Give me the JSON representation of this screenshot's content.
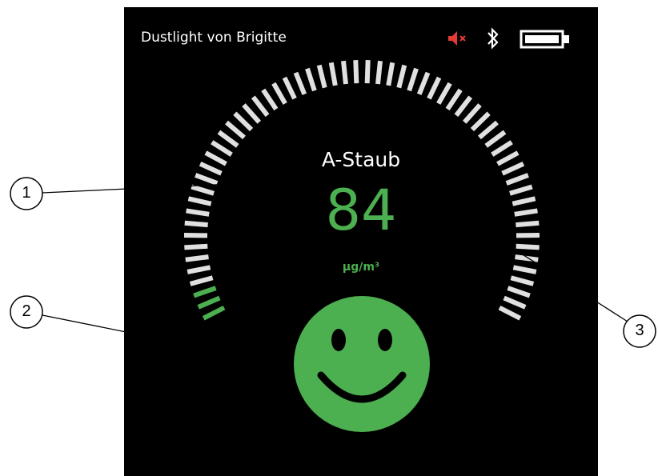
{
  "header": {
    "title": "Dustlight von Brigitte",
    "icons": [
      "speaker-muted-icon",
      "bluetooth-icon",
      "battery-icon"
    ]
  },
  "measurement": {
    "label": "A-Staub",
    "value": "84",
    "unit": "µg/m³",
    "gauge_fill_fraction": 0.05,
    "status": "good",
    "status_icon": "smiley-happy-icon"
  },
  "callouts": [
    "1",
    "2",
    "3"
  ],
  "colors": {
    "background": "#000000",
    "accent_green": "#4caf50",
    "gauge_inactive": "#e0e0e0",
    "mute_red": "#e53935"
  }
}
